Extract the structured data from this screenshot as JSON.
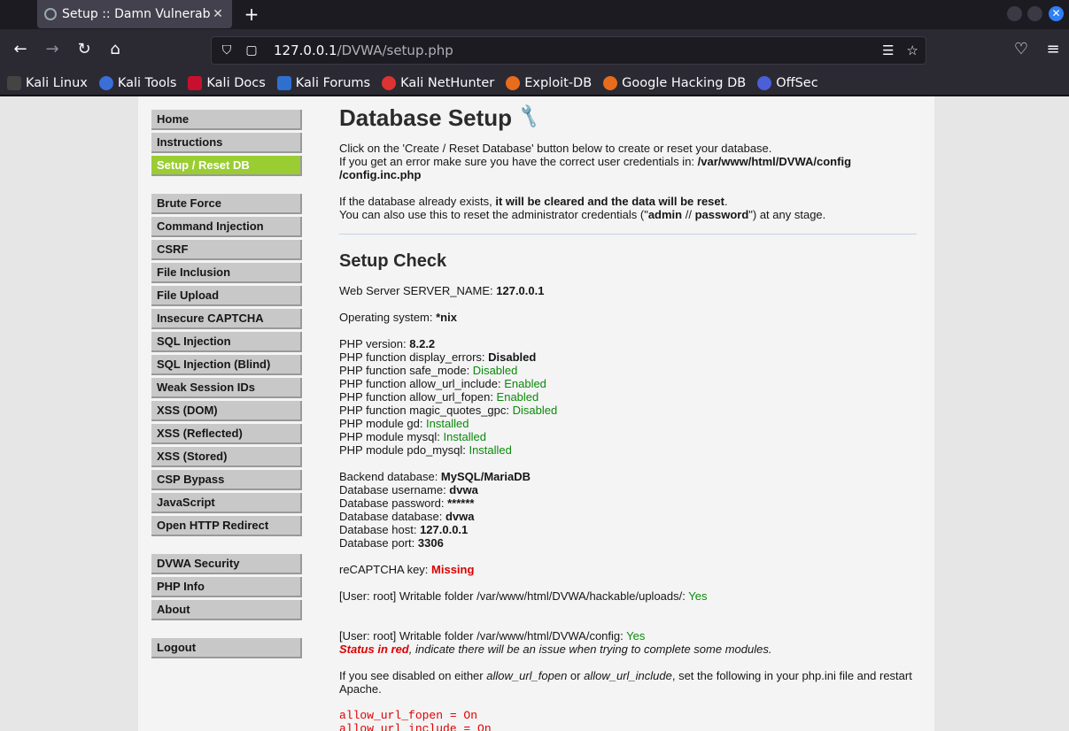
{
  "browser": {
    "tab_title": "Setup :: Damn Vulnerable",
    "url_host": "127.0.0.1",
    "url_path": "/DVWA/setup.php",
    "bookmarks": [
      "Kali Linux",
      "Kali Tools",
      "Kali Docs",
      "Kali Forums",
      "Kali NetHunter",
      "Exploit-DB",
      "Google Hacking DB",
      "OffSec"
    ]
  },
  "menu": {
    "group1": [
      "Home",
      "Instructions",
      "Setup / Reset DB"
    ],
    "group2": [
      "Brute Force",
      "Command Injection",
      "CSRF",
      "File Inclusion",
      "File Upload",
      "Insecure CAPTCHA",
      "SQL Injection",
      "SQL Injection (Blind)",
      "Weak Session IDs",
      "XSS (DOM)",
      "XSS (Reflected)",
      "XSS (Stored)",
      "CSP Bypass",
      "JavaScript",
      "Open HTTP Redirect"
    ],
    "group3": [
      "DVWA Security",
      "PHP Info",
      "About"
    ],
    "group4": [
      "Logout"
    ],
    "active": "Setup / Reset DB"
  },
  "content": {
    "title": "Database Setup",
    "intro1": "Click on the 'Create / Reset Database' button below to create or reset your database.",
    "intro2": "If you get an error make sure you have the correct user credentials in: ",
    "intro2_path": "/var/www/html/DVWA/config /config.inc.php",
    "intro3a": "If the database already exists, ",
    "intro3b": "it will be cleared and the data will be reset",
    "intro3c": ".",
    "intro4a": "You can also use this to reset the administrator credentials (\"",
    "intro4b": "admin",
    "intro4c": " // ",
    "intro4d": "password",
    "intro4e": "\") at any stage.",
    "setup_check": "Setup Check",
    "server_name_label": "Web Server SERVER_NAME: ",
    "server_name": "127.0.0.1",
    "os_label": "Operating system: ",
    "os": "*nix",
    "php_version_label": "PHP version: ",
    "php_version": "8.2.2",
    "php_checks": [
      {
        "label": "PHP function display_errors: ",
        "value": "Disabled",
        "style": "bold"
      },
      {
        "label": "PHP function safe_mode: ",
        "value": "Disabled",
        "style": "green"
      },
      {
        "label": "PHP function allow_url_include: ",
        "value": "Enabled",
        "style": "green"
      },
      {
        "label": "PHP function allow_url_fopen: ",
        "value": "Enabled",
        "style": "green"
      },
      {
        "label": "PHP function magic_quotes_gpc: ",
        "value": "Disabled",
        "style": "green"
      },
      {
        "label": "PHP module gd: ",
        "value": "Installed",
        "style": "green"
      },
      {
        "label": "PHP module mysql: ",
        "value": "Installed",
        "style": "green"
      },
      {
        "label": "PHP module pdo_mysql: ",
        "value": "Installed",
        "style": "green"
      }
    ],
    "db_rows": [
      {
        "label": "Backend database: ",
        "value": "MySQL/MariaDB"
      },
      {
        "label": "Database username: ",
        "value": "dvwa"
      },
      {
        "label": "Database password: ",
        "value": "******"
      },
      {
        "label": "Database database: ",
        "value": "dvwa"
      },
      {
        "label": "Database host: ",
        "value": "127.0.0.1"
      },
      {
        "label": "Database port: ",
        "value": "3306"
      }
    ],
    "recaptcha_label": "reCAPTCHA key: ",
    "recaptcha_value": "Missing",
    "uploads_label": "[User: root] Writable folder /var/www/html/DVWA/hackable/uploads/: ",
    "uploads_value": "Yes",
    "config_label": "[User: root] Writable folder /var/www/html/DVWA/config: ",
    "config_value": "Yes",
    "status_red": "Status in red",
    "status_rest": ", indicate there will be an issue when trying to complete some modules.",
    "disabled_a": "If you see disabled on either ",
    "disabled_b": "allow_url_fopen",
    "disabled_c": " or ",
    "disabled_d": "allow_url_include",
    "disabled_e": ", set the following in your php.ini file and restart Apache.",
    "code_lines": [
      "allow_url_fopen = On",
      "allow_url_include = On"
    ]
  }
}
